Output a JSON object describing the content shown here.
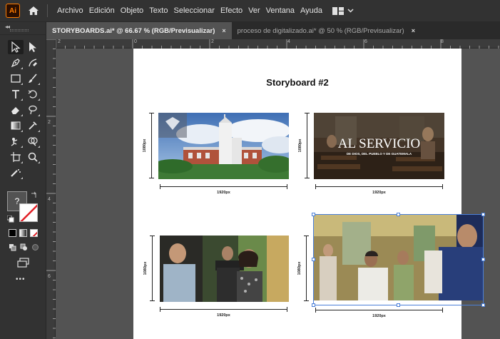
{
  "app": {
    "logo_text": "Ai",
    "brand_color": "#ff7c00",
    "menus": [
      "Archivo",
      "Edición",
      "Objeto",
      "Texto",
      "Seleccionar",
      "Efecto",
      "Ver",
      "Ventana",
      "Ayuda"
    ]
  },
  "tabs": [
    {
      "label": "STORYBOARDS.ai* @ 66.67 % (RGB/Previsualizar)",
      "close": "×",
      "active": true
    },
    {
      "label": "proceso de digitalizado.ai* @ 50 % (RGB/Previsualizar)",
      "close": "×",
      "active": false
    }
  ],
  "rulers": {
    "horizontal": [
      "2",
      "0",
      "2",
      "4",
      "6",
      "8"
    ],
    "vertical": [
      "2",
      "4",
      "6"
    ]
  },
  "toolbar": {
    "fill_stroke_help": "?",
    "more_tools": "•••",
    "icons": [
      "selection-icon",
      "direct-selection-icon",
      "pen-icon",
      "curvature-icon",
      "rectangle-icon",
      "paintbrush-icon",
      "type-icon",
      "rotate-icon",
      "eraser-icon",
      "lasso-icon",
      "gradient-icon",
      "eyedropper-icon",
      "puppet-warp-icon",
      "shape-builder-icon",
      "artboard-icon",
      "zoom-icon",
      "symbol-sprayer-icon"
    ]
  },
  "artboard": {
    "title": "Storyboard #2",
    "frames": [
      {
        "width_label": "1920px",
        "height_label": "1080px",
        "overlay_title": "",
        "overlay_sub": ""
      },
      {
        "width_label": "1920px",
        "height_label": "1080px",
        "overlay_title": "AL SERVICIO",
        "overlay_sub": "DE DIOS, DEL PUEBLO Y DE GUATEMALA"
      },
      {
        "width_label": "1920px",
        "height_label": "1080px",
        "overlay_title": "",
        "overlay_sub": ""
      },
      {
        "width_label": "1920px",
        "height_label": "1080px",
        "overlay_title": "",
        "overlay_sub": ""
      }
    ]
  },
  "colors": {
    "selection": "#4a7fd8",
    "ui_dark": "#323232",
    "canvas": "#535353"
  }
}
